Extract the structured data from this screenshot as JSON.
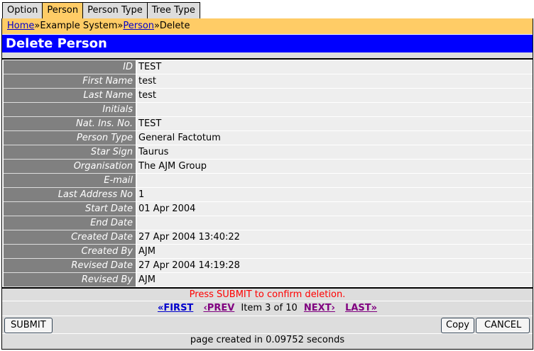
{
  "tabs": [
    {
      "label": "Option"
    },
    {
      "label": "Person"
    },
    {
      "label": "Person Type"
    },
    {
      "label": "Tree Type"
    }
  ],
  "breadcrumb": {
    "home": "Home",
    "sep1": "»",
    "system": "Example System",
    "sep2": "»",
    "person": "Person",
    "sep3": "»",
    "current": "Delete"
  },
  "title": "Delete Person",
  "fields": [
    {
      "label": "ID",
      "value": "TEST"
    },
    {
      "label": "First Name",
      "value": "test"
    },
    {
      "label": "Last Name",
      "value": "test"
    },
    {
      "label": "Initials",
      "value": ""
    },
    {
      "label": "Nat. Ins. No.",
      "value": "TEST"
    },
    {
      "label": "Person Type",
      "value": "General Factotum"
    },
    {
      "label": "Star Sign",
      "value": "Taurus"
    },
    {
      "label": "Organisation",
      "value": "The AJM Group"
    },
    {
      "label": "E-mail",
      "value": ""
    },
    {
      "label": "Last Address No",
      "value": "1"
    },
    {
      "label": "Start Date",
      "value": "01 Apr 2004"
    },
    {
      "label": "End Date",
      "value": ""
    },
    {
      "label": "Created Date",
      "value": "27 Apr 2004 13:40:22"
    },
    {
      "label": "Created By",
      "value": "AJM"
    },
    {
      "label": "Revised Date",
      "value": "27 Apr 2004 14:19:28"
    },
    {
      "label": "Revised By",
      "value": "AJM"
    }
  ],
  "message": "Press SUBMIT to confirm deletion.",
  "nav": {
    "first": "«FIRST",
    "prev": "‹PREV",
    "item": "Item 3 of 10",
    "next": "NEXT›",
    "last": "LAST»"
  },
  "buttons": {
    "submit": "SUBMIT",
    "copy": "Copy",
    "cancel": "CANCEL"
  },
  "footer": "page created in 0.09752 seconds"
}
